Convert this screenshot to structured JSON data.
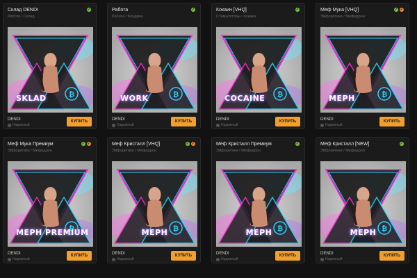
{
  "buy_label": "КУПИТЬ",
  "status_label": "Надежный",
  "cards": [
    {
      "title": "Склад DENDI",
      "subtitle": "Работа / Склад",
      "seller": "DENDI",
      "badges": [
        "green"
      ],
      "art_label": "SKLAD",
      "art_side": "left"
    },
    {
      "title": "Работа",
      "subtitle": "Работа / Кладмен",
      "seller": "DENDI",
      "badges": [
        "green"
      ],
      "art_label": "WORK",
      "art_side": "left"
    },
    {
      "title": "Кокаин [VHQ]",
      "subtitle": "Стимуляторы / Кокаин",
      "seller": "DENDI",
      "badges": [
        "green"
      ],
      "art_label": "COCAINE",
      "art_side": "left"
    },
    {
      "title": "Меф Мука [VHQ]",
      "subtitle": "Эйфоретики / Мефедрон",
      "seller": "DENDI",
      "badges": [
        "green",
        "orange"
      ],
      "art_label": "MEPH",
      "art_side": "left"
    },
    {
      "title": "Меф Мука Премиум",
      "subtitle": "Эйфоретики / Мефедрон",
      "seller": "DENDI",
      "badges": [
        "green",
        "orange"
      ],
      "art_label": "MEPH PREMIUM",
      "art_side": "left"
    },
    {
      "title": "Меф Кристалл [VHQ]",
      "subtitle": "Эйфоретики / Мефедрон",
      "seller": "DENDI",
      "badges": [
        "green",
        "orange"
      ],
      "art_label": "MEPH",
      "art_side": "center"
    },
    {
      "title": "Меф Кристалл Премиум",
      "subtitle": "Эйфоретики / Мефедрон",
      "seller": "DENDI",
      "badges": [
        "green"
      ],
      "art_label": "MEPH",
      "art_side": "center"
    },
    {
      "title": "Меф Кристалл [NEW]",
      "subtitle": "Эйфоретики / Мефедрон",
      "seller": "DENDI",
      "badges": [
        "green"
      ],
      "art_label": "MEPH",
      "art_side": "center"
    }
  ],
  "colors": {
    "accent": "#f2a02d",
    "badge_green": "#7ac143",
    "badge_orange": "#e8883a",
    "neon_pink": "#ff2bd6",
    "neon_cyan": "#28d6ff"
  }
}
